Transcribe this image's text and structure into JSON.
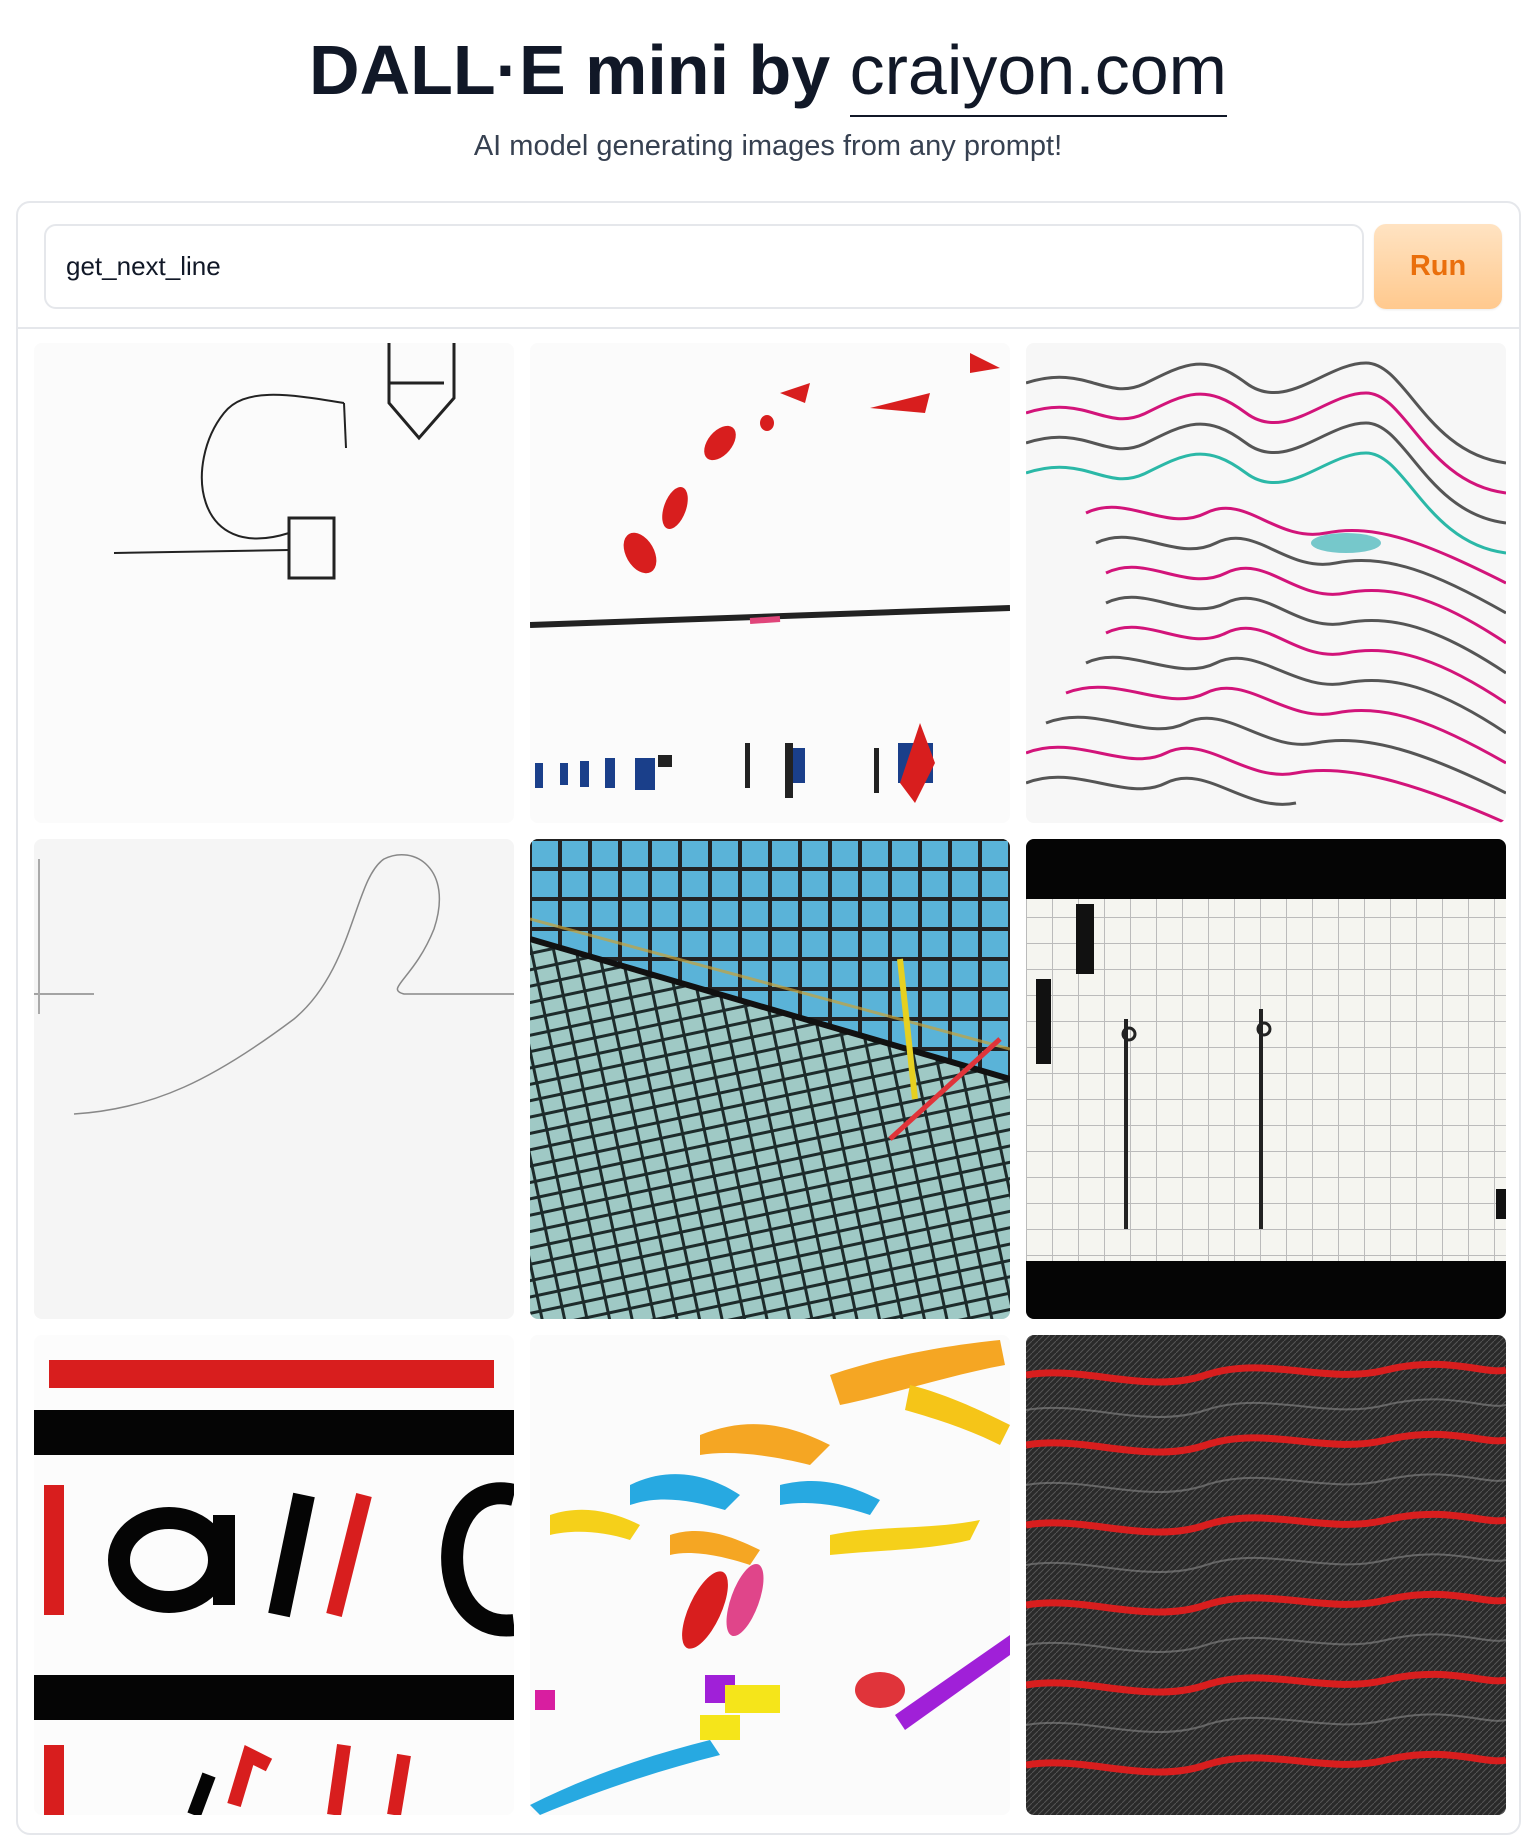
{
  "header": {
    "title_main": "DALL·E mini by ",
    "title_link": "craiyon.com",
    "subtitle": "AI model generating images from any prompt!"
  },
  "prompt": {
    "value": "get_next_line"
  },
  "run_button": {
    "label": "Run"
  },
  "results": {
    "count": 9
  },
  "colors": {
    "accent": "#ea6f0c",
    "run_bg": "#ffd2a0",
    "border": "#e5e7eb"
  }
}
